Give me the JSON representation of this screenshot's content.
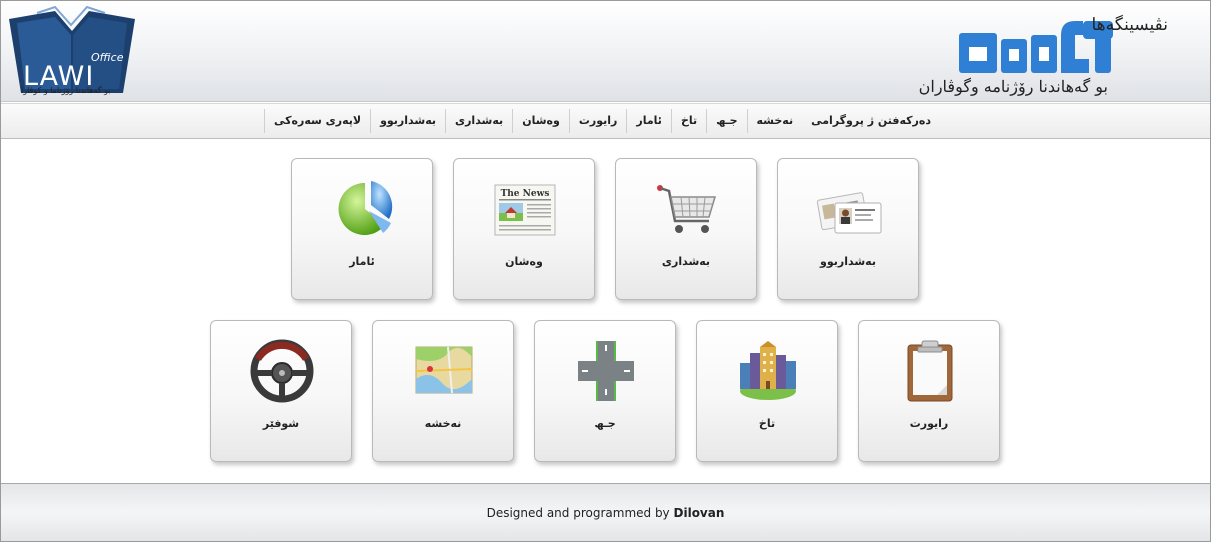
{
  "header": {
    "office_logo": {
      "word": "LAWI",
      "badge": "Office",
      "caption": "بو گەهاندنا رۆژناما و كوڤارا",
      "icon": "open-book-icon"
    },
    "brand": {
      "mark_icon": "lawi-arabic-logo",
      "top_text": "نڤیسینگەها",
      "subtitle": "بو گەهاندنا رۆژنامە وگوڤاران"
    }
  },
  "nav": {
    "items": [
      "لاپەری سەرەکی",
      "بەشداربوو",
      "بەشداری",
      "وەشان",
      "رایورت",
      "ئامار",
      "تاخ",
      "جـھ",
      "نەخشە",
      "دەرکەفتن ژ پروگرامی"
    ]
  },
  "tiles": [
    {
      "label": "بەشداربوو",
      "icon": "id-cards-icon"
    },
    {
      "label": "بەشداری",
      "icon": "shopping-cart-icon"
    },
    {
      "label": "وەشان",
      "icon": "newspaper-icon"
    },
    {
      "label": "ئامار",
      "icon": "pie-chart-icon"
    },
    {
      "label": "رایورت",
      "icon": "clipboard-icon"
    },
    {
      "label": "تاخ",
      "icon": "city-buildings-icon"
    },
    {
      "label": "جـھ",
      "icon": "road-crossing-icon"
    },
    {
      "label": "نەخشە",
      "icon": "map-icon"
    },
    {
      "label": "شوفێر",
      "icon": "steering-wheel-icon"
    }
  ],
  "newspaper_heading": "The News",
  "footer": {
    "prefix": "Designed and programmed by",
    "author": "Dilovan"
  },
  "colors": {
    "brand_blue": "#2f7fd4",
    "logo_navy": "#1d3f6e"
  }
}
